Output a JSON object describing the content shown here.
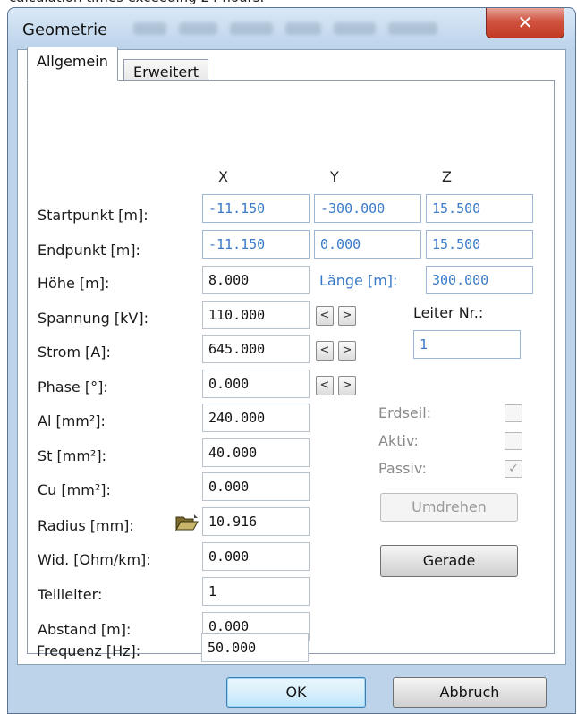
{
  "caption": "calculation times exceeding 24 hours.",
  "window": {
    "title": "Geometrie",
    "close_glyph": "✕"
  },
  "tabs": [
    "Allgemein",
    "Erweitert"
  ],
  "columns": {
    "x": "X",
    "y": "Y",
    "z": "Z"
  },
  "rows": {
    "startpunkt": {
      "label": "Startpunkt [m]:",
      "x": "-11.150",
      "y": "-300.000",
      "z": "15.500"
    },
    "endpunkt": {
      "label": "Endpunkt [m]:",
      "x": "-11.150",
      "y": "0.000",
      "z": "15.500"
    },
    "hoehe": {
      "label": "Höhe [m]:",
      "value": "8.000",
      "laenge_label": "Länge [m]:",
      "laenge_value": "300.000"
    },
    "spannung": {
      "label": "Spannung [kV]:",
      "value": "110.000"
    },
    "strom": {
      "label": "Strom [A]:",
      "value": "645.000"
    },
    "phase": {
      "label": "Phase [°]:",
      "value": "0.000"
    },
    "al": {
      "label": "Al [mm²]:",
      "value": "240.000"
    },
    "st": {
      "label": "St [mm²]:",
      "value": "40.000"
    },
    "cu": {
      "label": "Cu [mm²]:",
      "value": "0.000"
    },
    "radius": {
      "label": "Radius [mm]:",
      "value": "10.916"
    },
    "widerstand": {
      "label": "Wid. [Ohm/km]:",
      "value": "0.000"
    },
    "teilleiter": {
      "label": "Teilleiter:",
      "value": "1"
    },
    "abstand": {
      "label": "Abstand [m]:",
      "value": "0.000"
    },
    "frequenz": {
      "label": "Frequenz [Hz]:",
      "value": "50.000"
    }
  },
  "arrows": {
    "left": "<",
    "right": ">"
  },
  "leiter": {
    "label": "Leiter Nr.:",
    "value": "1"
  },
  "checkboxes": {
    "erdseil": {
      "label": "Erdseil:",
      "checked": false
    },
    "aktiv": {
      "label": "Aktiv:",
      "checked": false
    },
    "passiv": {
      "label": "Passiv:",
      "checked": true,
      "mark": "✓"
    }
  },
  "buttons": {
    "umdrehen": "Umdrehen",
    "gerade": "Gerade",
    "ok": "OK",
    "abbruch": "Abbruch"
  },
  "colors": {
    "accent_blue": "#3a7ac8",
    "window_frame": "#bcd3ea",
    "close_red": "#c23a25"
  }
}
